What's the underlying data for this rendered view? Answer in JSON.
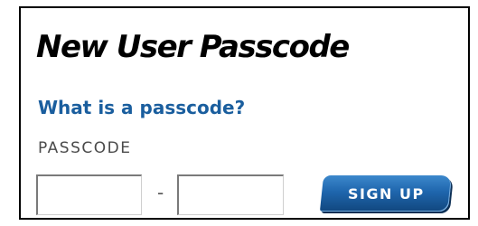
{
  "form": {
    "title": "New User Passcode",
    "help_link": "What is a passcode?",
    "field_label": "PASSCODE",
    "separator": "-",
    "passcode_part1": {
      "value": "",
      "placeholder": ""
    },
    "passcode_part2": {
      "value": "",
      "placeholder": ""
    },
    "signup_label": "SIGN UP"
  },
  "colors": {
    "link": "#1a5e9e",
    "button": "#1f66ad",
    "border": "#000000"
  }
}
